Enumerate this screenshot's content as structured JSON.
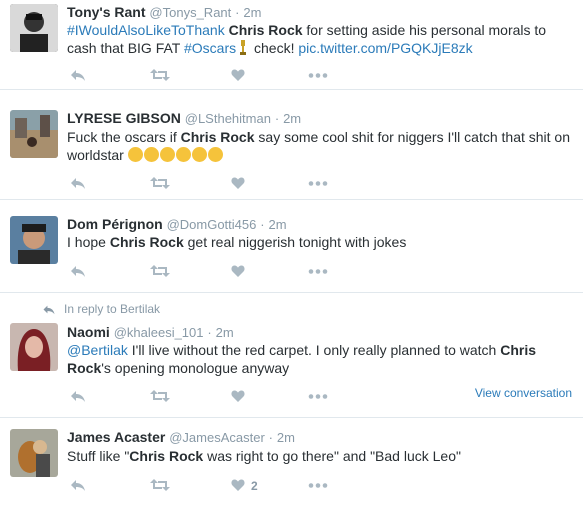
{
  "tweets": [
    {
      "name": "Tony's Rant",
      "handle": "@Tonys_Rant",
      "sep": "·",
      "time": "2m",
      "text": {
        "hashtag1": "#IWouldAlsoLikeToThank",
        "bold1": "Chris Rock",
        "t1": "for setting aside his personal morals to cash that BIG FAT",
        "hashtag2": "#Oscars",
        "t2": "check!",
        "link": "pic.twitter.com/PGQKJjE8zk"
      }
    },
    {
      "name": "LYRESE GIBSON",
      "handle": "@LSthehitman",
      "sep": "·",
      "time": "2m",
      "text": {
        "t1": "Fuck the oscars if",
        "bold1": "Chris Rock",
        "t2": "say some cool shit for niggers I'll catch that shit on worldstar"
      }
    },
    {
      "name": "Dom Pérignon",
      "handle": "@DomGotti456",
      "sep": "·",
      "time": "2m",
      "text": {
        "t1": "I hope",
        "bold1": "Chris Rock",
        "t2": "get real niggerish tonight with jokes"
      }
    },
    {
      "reply_context": "In reply to Bertilak",
      "name": "Naomi",
      "handle": "@khaleesi_101",
      "sep": "·",
      "time": "2m",
      "text": {
        "mention": "@Bertilak",
        "t1": "I'll live without the red carpet. I only really planned to watch",
        "bold1": "Chris Rock",
        "t2": "'s opening monologue anyway"
      },
      "view_conversation": "View conversation"
    },
    {
      "name": "James Acaster",
      "handle": "@JamesAcaster",
      "sep": "·",
      "time": "2m",
      "text": {
        "t1": "Stuff like \"",
        "bold1": "Chris Rock",
        "t2": "was right to go there\" and \"Bad luck Leo\""
      },
      "like_count": "2"
    }
  ],
  "icons": {
    "reply": "reply-icon",
    "retweet": "retweet-icon",
    "like": "heart-icon",
    "more": "more-icon",
    "emoji": "face-with-tears-of-joy-icon",
    "trophy": "trophy-icon"
  },
  "colors": {
    "link": "#2b7bb9",
    "muted": "#8899a6",
    "text": "#292f33",
    "border": "#e1e8ed",
    "action": "#aab8c2"
  }
}
